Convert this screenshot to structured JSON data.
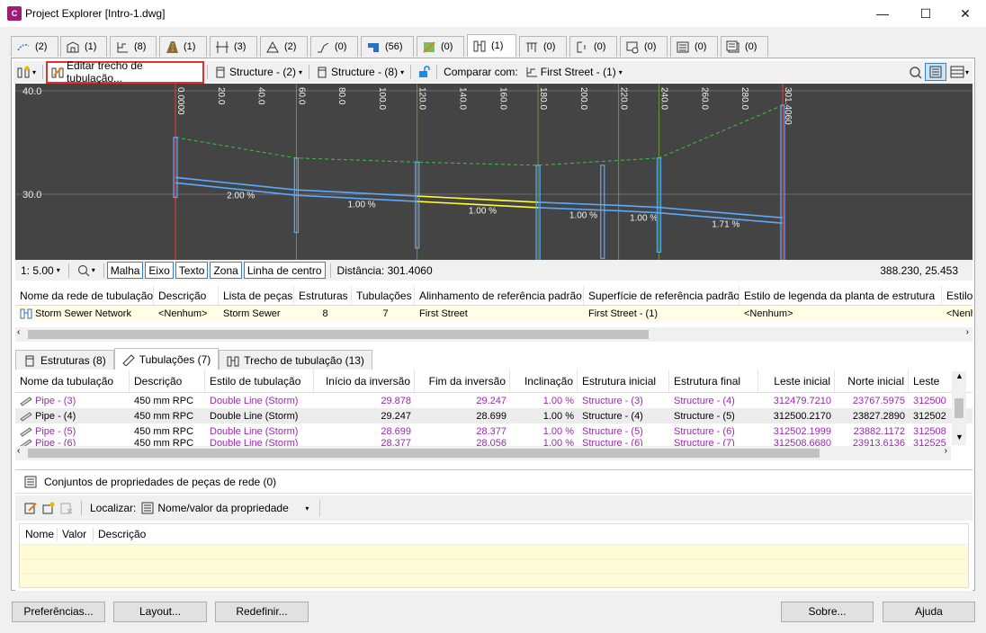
{
  "window": {
    "title": "Project Explorer [Intro-1.dwg]",
    "app_icon": "C",
    "controls": {
      "minimize": "—",
      "maximize": "☐",
      "close": "✕"
    }
  },
  "top_tabs": [
    {
      "icon": "alignment-icon",
      "count": "(2)"
    },
    {
      "icon": "sites-icon",
      "count": "(1)"
    },
    {
      "icon": "profile-view-icon",
      "count": "(8)"
    },
    {
      "icon": "corridor-icon",
      "count": "(1)"
    },
    {
      "icon": "sample-lines-icon",
      "count": "(3)"
    },
    {
      "icon": "surface-icon",
      "count": "(2)"
    },
    {
      "icon": "feature-line-icon",
      "count": "(0)"
    },
    {
      "icon": "parcel-icon",
      "count": "(56)"
    },
    {
      "icon": "grading-icon",
      "count": "(0)"
    },
    {
      "icon": "pipe-network-icon",
      "count": "(1)"
    },
    {
      "icon": "pressure-network-icon",
      "count": "(0)"
    },
    {
      "icon": "view-frame-icon",
      "count": "(0)"
    },
    {
      "icon": "match-line-icon",
      "count": "(0)"
    },
    {
      "icon": "sheets-icon",
      "count": "(0)"
    },
    {
      "icon": "data-shortcut-icon",
      "count": "(0)"
    }
  ],
  "toolbar": {
    "edit_run": "Editar trecho de tubulação...",
    "structure_a": "Structure - (2)",
    "structure_b": "Structure - (8)",
    "compare_label": "Comparar com:",
    "compare_value": "First Street - (1)"
  },
  "profile": {
    "y_labels": [
      "40.0",
      "30.0"
    ],
    "stations": [
      "0.0000",
      "20.0",
      "40.0",
      "60.0",
      "80.0",
      "100.0",
      "120.0",
      "140.0",
      "160.0",
      "180.0",
      "200.0",
      "220.0",
      "240.0",
      "260.0",
      "280.0",
      "301.4060"
    ],
    "slopes": [
      "2.00 %",
      "1.00 %",
      "1.00 %",
      "1.00 %",
      "1.00 %",
      "1.71 %"
    ]
  },
  "status": {
    "scale": "1: 5.00",
    "chips": [
      "Malha",
      "Eixo",
      "Texto",
      "Zona",
      "Linha de centro"
    ],
    "distance": "Distância: 301.4060",
    "coords": "388.230, 25.453"
  },
  "network_grid": {
    "headers": [
      "Nome da rede de tubulação",
      "Descrição",
      "Lista de peças",
      "Estruturas",
      "Tubulações",
      "Alinhamento de referência padrão",
      "Superfície de referência padrão",
      "Estilo de legenda da planta de estrutura",
      "Estilo d"
    ],
    "row": [
      "Storm Sewer Network",
      "<Nenhum>",
      "Storm Sewer",
      "8",
      "7",
      "First Street",
      "First Street - (1)",
      "<Nenhum>",
      "<Nenh"
    ]
  },
  "subtabs": [
    {
      "label": "Estruturas (8)"
    },
    {
      "label": "Tubulações (7)"
    },
    {
      "label": "Trecho de tubulação (13)"
    }
  ],
  "pipes_grid": {
    "headers": [
      "Nome da tubulação",
      "Descrição",
      "Estilo de tubulação",
      "Início da inversão",
      "Fim da inversão",
      "Inclinação",
      "Estrutura inicial",
      "Estrutura final",
      "Leste inicial",
      "Norte inicial",
      "Leste"
    ],
    "rows": [
      [
        "Pipe - (3)",
        "450 mm RPC",
        "Double Line (Storm)",
        "29.878",
        "29.247",
        "1.00 %",
        "Structure - (3)",
        "Structure - (4)",
        "312479.7210",
        "23767.5975",
        "312500"
      ],
      [
        "Pipe - (4)",
        "450 mm RPC",
        "Double Line (Storm)",
        "29.247",
        "28.699",
        "1.00 %",
        "Structure - (4)",
        "Structure - (5)",
        "312500.2170",
        "23827.2890",
        "312502"
      ],
      [
        "Pipe - (5)",
        "450 mm RPC",
        "Double Line (Storm)",
        "28.699",
        "28.377",
        "1.00 %",
        "Structure - (5)",
        "Structure - (6)",
        "312502.1999",
        "23882.1172",
        "312508"
      ],
      [
        "Pipe - (6)",
        "450 mm RPC",
        "Double Line (Storm)",
        "28.377",
        "28.056",
        "1.00 %",
        "Structure - (6)",
        "Structure - (7)",
        "312508.6680",
        "23913.6136",
        "312525"
      ]
    ]
  },
  "property_sets": {
    "title": "Conjuntos de propriedades de peças de rede (0)",
    "find_label": "Localizar:",
    "find_value": "Nome/valor da propriedade",
    "headers": [
      "Nome",
      "Valor",
      "Descrição"
    ]
  },
  "buttons": {
    "prefs": "Preferências...",
    "layout": "Layout...",
    "reset": "Redefinir...",
    "about": "Sobre...",
    "help": "Ajuda"
  },
  "colors": {
    "accent": "#3b7dc9",
    "highlight": "#e03030",
    "pipe": "#5aa9ff",
    "selected_pipe": "#ffff33",
    "ground": "#34c759",
    "purple": "#9b28b0"
  }
}
